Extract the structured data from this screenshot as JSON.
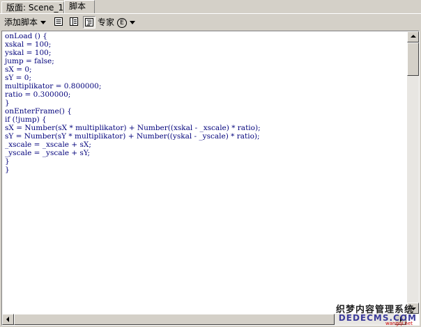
{
  "tabs": [
    {
      "label": "版面: Scene_1"
    },
    {
      "label": "脚本"
    }
  ],
  "toolbar": {
    "add_menu_label": "添加脚本",
    "expert_label": "专家",
    "expert_badge": "E"
  },
  "editor": {
    "code": "onLoad () {\nxskal = 100;\nyskal = 100;\njump = false;\nsX = 0;\nsY = 0;\nmultiplikator = 0.800000;\nratio = 0.300000;\n}\nonEnterFrame() {\nif (!jump) {\nsX = Number(sX * multiplikator) + Number((xskal - _xscale) * ratio);\nsY = Number(sY * multiplikator) + Number((yskal - _yscale) * ratio);\n_xscale = _xscale + sX;\n_yscale = _yscale + sY;\n}\n}"
  },
  "watermark": {
    "line1": "织梦内容管理系统",
    "line2": "DEDECMS.COM",
    "line3": "wangqi.net"
  }
}
